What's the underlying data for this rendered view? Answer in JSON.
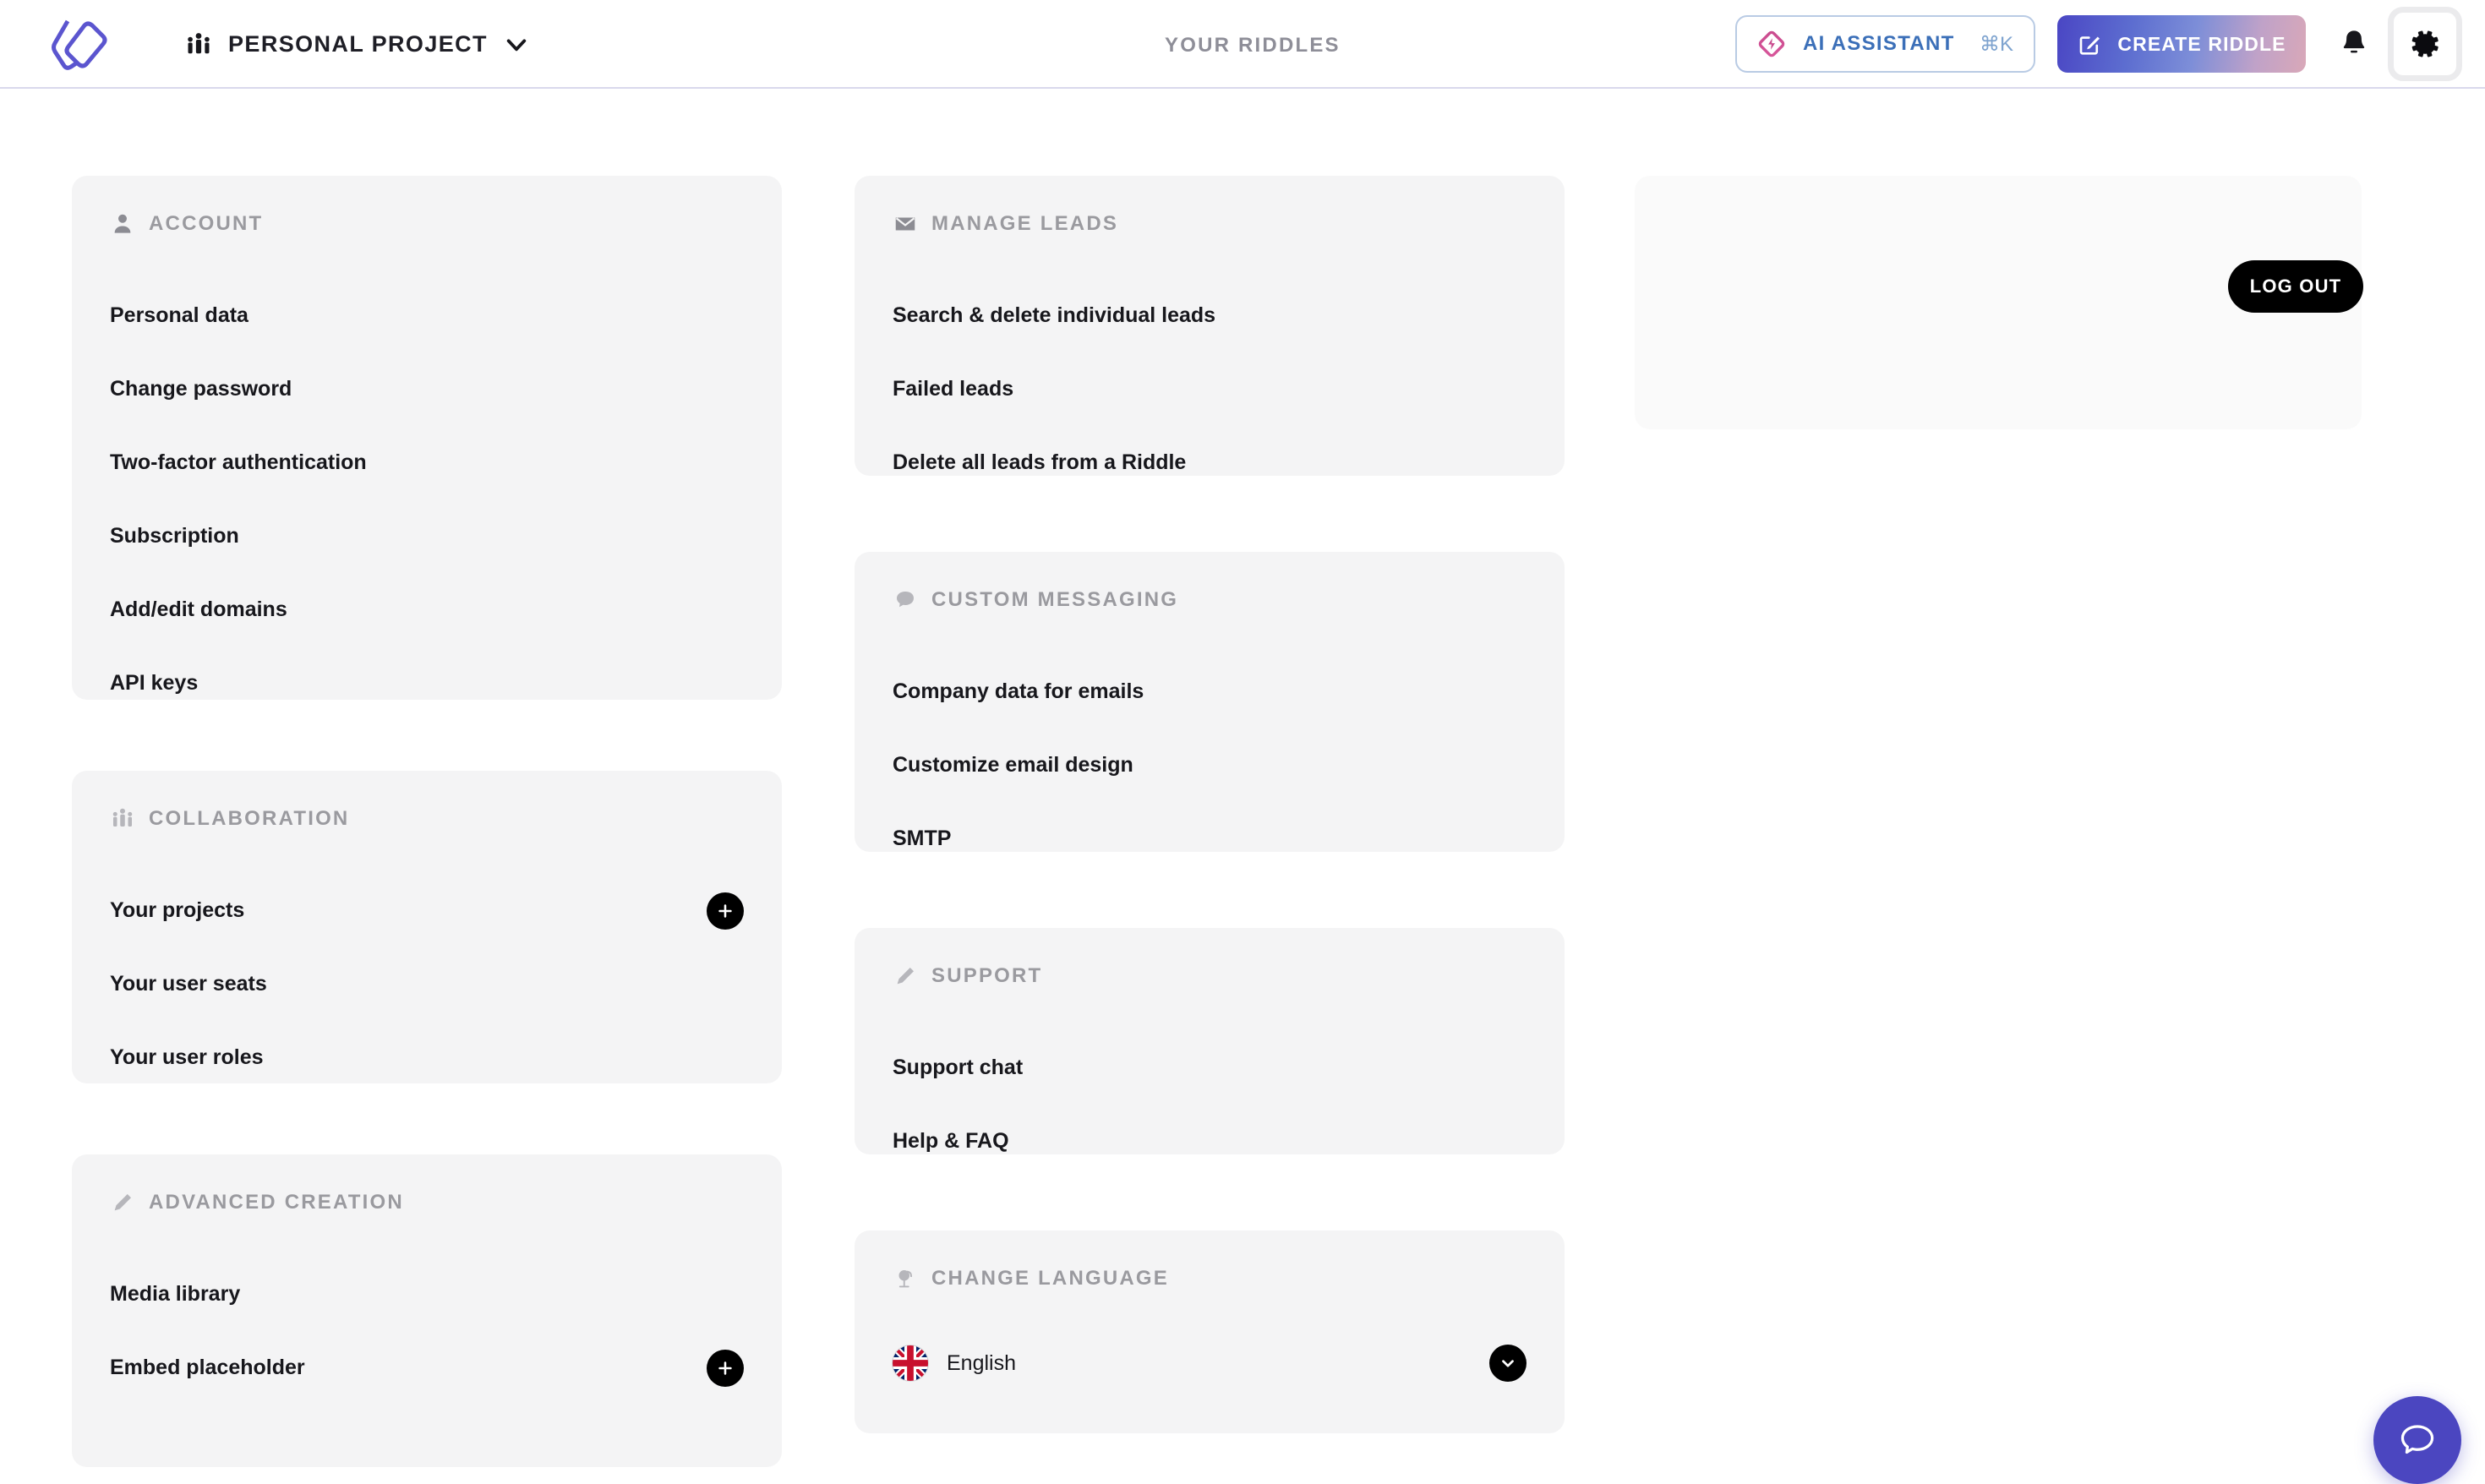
{
  "header": {
    "logo_icon": "riddle-logo-icon",
    "project_icon": "people-group-icon",
    "project_name": "PERSONAL PROJECT",
    "project_chevron_icon": "chevron-down-icon",
    "page_label": "YOUR RIDDLES",
    "ai_assistant": {
      "icon": "ai-diamond-icon",
      "label": "AI ASSISTANT",
      "shortcut": "⌘K",
      "border_color": "#b9cbe4",
      "text_color": "#3b6fb8"
    },
    "create_riddle": {
      "icon": "compose-pencil-icon",
      "label": "CREATE RIDDLE",
      "gradient_from": "#4a46c4",
      "gradient_to": "#d9a8b8"
    },
    "notifications_icon": "bell-icon",
    "settings_icon": "gear-icon"
  },
  "logout": {
    "label": "LOG OUT"
  },
  "chat_widget": {
    "icon": "chat-bubble-icon",
    "color": "#4b46c0"
  },
  "cards": {
    "account": {
      "icon": "person-icon",
      "title": "ACCOUNT",
      "items": [
        {
          "label": "Personal data"
        },
        {
          "label": "Change password"
        },
        {
          "label": "Two-factor authentication"
        },
        {
          "label": "Subscription"
        },
        {
          "label": "Add/edit domains"
        },
        {
          "label": "API keys"
        }
      ]
    },
    "collaboration": {
      "icon": "people-group-icon",
      "title": "COLLABORATION",
      "items": [
        {
          "label": "Your projects",
          "action_icon": "plus-icon"
        },
        {
          "label": "Your user seats"
        },
        {
          "label": "Your user roles"
        }
      ]
    },
    "advanced_creation": {
      "icon": "pencil-icon",
      "title": "ADVANCED CREATION",
      "items": [
        {
          "label": "Media library"
        },
        {
          "label": "Embed placeholder",
          "action_icon": "plus-icon"
        }
      ]
    },
    "manage_leads": {
      "icon": "envelope-icon",
      "title": "MANAGE LEADS",
      "items": [
        {
          "label": "Search & delete individual leads"
        },
        {
          "label": "Failed leads"
        },
        {
          "label": "Delete all leads from a Riddle"
        }
      ]
    },
    "custom_messaging": {
      "icon": "speech-bubble-icon",
      "title": "CUSTOM MESSAGING",
      "items": [
        {
          "label": "Company data for emails"
        },
        {
          "label": "Customize email design"
        },
        {
          "label": "SMTP"
        }
      ]
    },
    "support": {
      "icon": "pencil-icon",
      "title": "SUPPORT",
      "items": [
        {
          "label": "Support chat"
        },
        {
          "label": "Help & FAQ"
        }
      ]
    },
    "change_language": {
      "icon": "globe-icon",
      "title": "CHANGE LANGUAGE",
      "selected": {
        "flag": "uk-flag-icon",
        "label": "English"
      },
      "chevron_icon": "chevron-down-icon"
    }
  }
}
